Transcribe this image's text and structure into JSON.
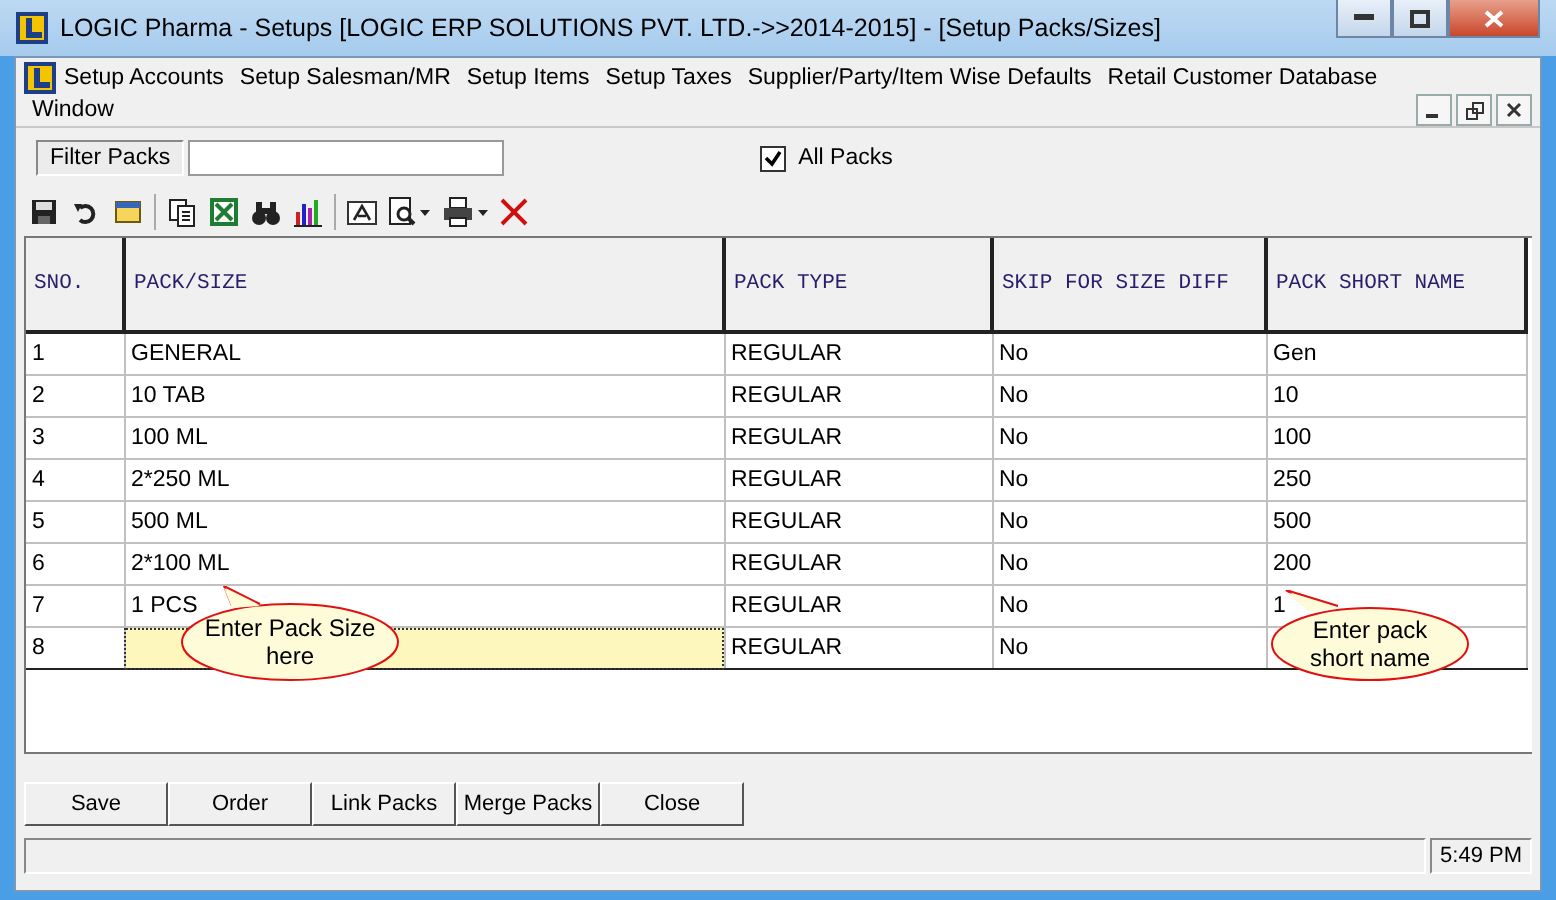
{
  "window": {
    "title": "LOGIC Pharma - Setups  [LOGIC ERP SOLUTIONS PVT. LTD.->>2014-2015] - [Setup Packs/Sizes]"
  },
  "menu": [
    "Setup Accounts",
    "Setup Salesman/MR",
    "Setup Items",
    "Setup Taxes",
    "Supplier/Party/Item Wise Defaults",
    "Retail Customer Database",
    "Window"
  ],
  "filter": {
    "label": "Filter Packs"
  },
  "all_packs": {
    "label": "All Packs",
    "checked": true
  },
  "table": {
    "columns": [
      "SNO.",
      "PACK/SIZE",
      "PACK TYPE",
      "SKIP FOR SIZE DIFF",
      "PACK SHORT NAME"
    ],
    "rows": [
      {
        "sno": "1",
        "pack": "GENERAL",
        "type": "REGULAR",
        "skip": "No",
        "short": "Gen",
        "current": false
      },
      {
        "sno": "2",
        "pack": "10 TAB",
        "type": "REGULAR",
        "skip": "No",
        "short": "10",
        "current": false
      },
      {
        "sno": "3",
        "pack": "100 ML",
        "type": "REGULAR",
        "skip": "No",
        "short": "100",
        "current": false
      },
      {
        "sno": "4",
        "pack": "2*250 ML",
        "type": "REGULAR",
        "skip": "No",
        "short": "250",
        "current": false
      },
      {
        "sno": "5",
        "pack": "500 ML",
        "type": "REGULAR",
        "skip": "No",
        "short": "500",
        "current": false
      },
      {
        "sno": "6",
        "pack": "2*100 ML",
        "type": "REGULAR",
        "skip": "No",
        "short": "200",
        "current": false
      },
      {
        "sno": "7",
        "pack": "1 PCS",
        "type": "REGULAR",
        "skip": "No",
        "short": "1",
        "current": false
      },
      {
        "sno": "8",
        "type": "REGULAR",
        "skip": "No",
        "current": true
      }
    ]
  },
  "callouts": [
    {
      "text": "Enter Pack Size here"
    },
    {
      "text": "Enter pack short name"
    }
  ],
  "buttons": [
    "Save",
    "Order",
    "Link Packs",
    "Merge Packs",
    "Close"
  ],
  "status_bar": {
    "time": "5:49 PM"
  }
}
